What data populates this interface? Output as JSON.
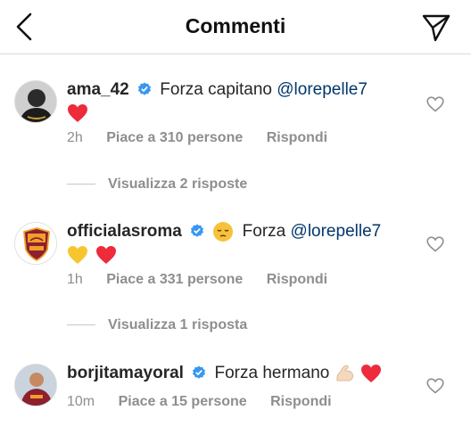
{
  "header": {
    "title": "Commenti",
    "back_icon": "chevron-left-icon",
    "send_icon": "paper-plane-icon"
  },
  "colors": {
    "heart_red": "#ed2b3b",
    "verified_blue": "#3897f0",
    "mention_blue": "#00376b",
    "meta_gray": "#8e8e8e",
    "roma_orange": "#f0a02a",
    "roma_red": "#8e1f2f"
  },
  "comments": [
    {
      "username": "ama_42",
      "text": "Forza capitano",
      "mention": "@lorepelle7",
      "second_line_emojis": [
        "red-heart"
      ],
      "time": "2h",
      "likes": "Piace a 310 persone",
      "reply": "Rispondi",
      "view_replies": "Visualizza 2 risposte"
    },
    {
      "username": "officialasroma",
      "inline_emoji": "pensive-face",
      "text": "Forza",
      "mention": "@lorepelle7",
      "second_line_emojis": [
        "yellow-heart",
        "red-heart"
      ],
      "time": "1h",
      "likes": "Piace a 331 persone",
      "reply": "Rispondi",
      "view_replies": "Visualizza 1 risposta"
    },
    {
      "username": "borjitamayoral",
      "text": "Forza hermano",
      "trailing_emojis": [
        "flexed-biceps",
        "red-heart"
      ],
      "time": "10m",
      "likes": "Piace a 15 persone",
      "reply": "Rispondi"
    }
  ]
}
